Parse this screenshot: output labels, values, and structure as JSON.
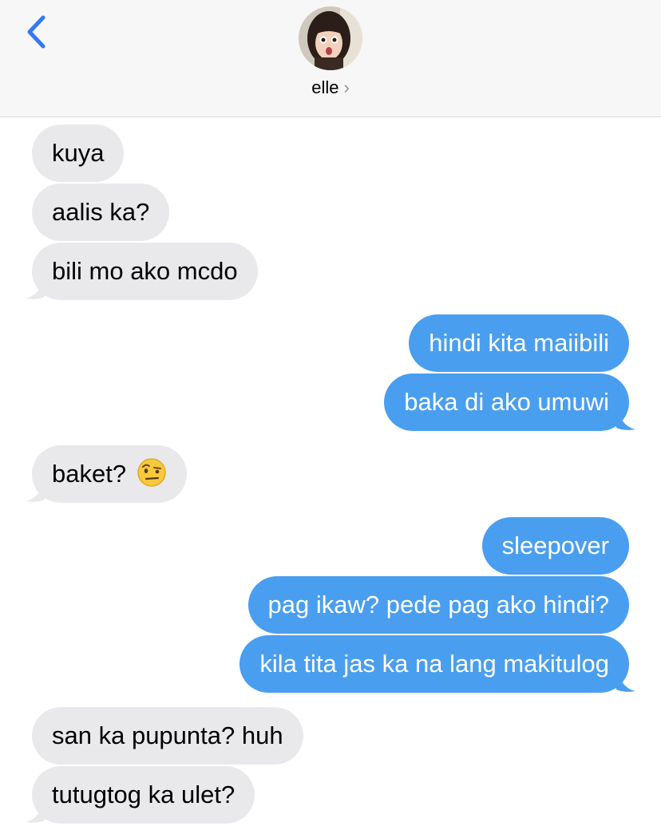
{
  "header": {
    "contact_name": "elle",
    "chevron": "›",
    "back_icon": "chevron-left-icon",
    "accent_color": "#3478f6"
  },
  "colors": {
    "received_bubble": "#e9e9eb",
    "sent_bubble": "#4a9eef"
  },
  "messages": [
    {
      "direction": "received",
      "text": "kuya"
    },
    {
      "direction": "received",
      "text": "aalis ka?"
    },
    {
      "direction": "received",
      "text": "bili mo ako mcdo"
    },
    {
      "direction": "sent",
      "text": "hindi kita maiibili"
    },
    {
      "direction": "sent",
      "text": "baka di ako umuwi"
    },
    {
      "direction": "received",
      "text": "baket?",
      "emoji": "face-with-raised-eyebrow-icon"
    },
    {
      "direction": "sent",
      "text": "sleepover"
    },
    {
      "direction": "sent",
      "text": "pag ikaw? pede pag ako hindi?"
    },
    {
      "direction": "sent",
      "text": "kila tita jas ka na lang makitulog"
    },
    {
      "direction": "received",
      "text": "san ka pupunta? huh"
    },
    {
      "direction": "received",
      "text": "tutugtog ka ulet?"
    }
  ]
}
